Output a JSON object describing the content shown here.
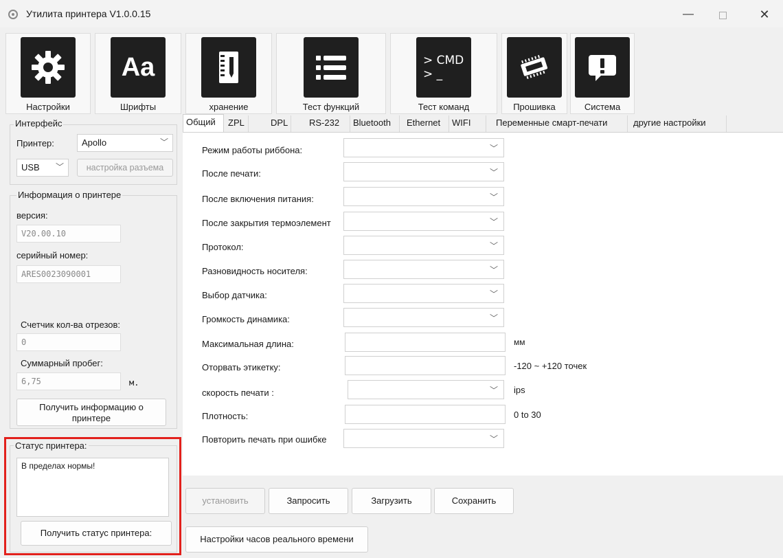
{
  "window": {
    "title": "Утилита принтера  V1.0.0.15",
    "controls": {
      "minimize": "—",
      "close": "✕"
    }
  },
  "toolbar": {
    "buttons": [
      {
        "id": "settings",
        "label": "Настройки",
        "icon": "gear-icon"
      },
      {
        "id": "fonts",
        "label": "Шрифты",
        "icon": "fonts-icon",
        "glyph": "Aa"
      },
      {
        "id": "storage",
        "label": "хранение",
        "icon": "notebook-icon"
      },
      {
        "id": "func_test",
        "label": "Тест функций",
        "icon": "list-icon"
      },
      {
        "id": "cmd_test",
        "label": "Тест команд",
        "icon": "terminal-icon",
        "glyph_line1": "> CMD",
        "glyph_line2": "> _"
      },
      {
        "id": "firmware",
        "label": "Прошивка",
        "icon": "chip-icon"
      },
      {
        "id": "system",
        "label": "Система",
        "icon": "alert-icon",
        "glyph": "!"
      }
    ]
  },
  "interface": {
    "title": "Интерфейс",
    "printer_label": "Принтер:",
    "printer_value": "Apollo",
    "port_value": "USB",
    "port_settings_button": "настройка разъема"
  },
  "printer_info": {
    "title": "Информация о принтере",
    "version_label": "версия:",
    "version_value": "V20.00.10",
    "serial_label": "серийный номер:",
    "serial_value": "ARES0023090001",
    "cut_counter_label": "Счетчик кол-ва отрезов:",
    "cut_counter_value": "0",
    "mileage_label": "Суммарный пробег:",
    "mileage_value": "6,75",
    "mileage_unit": "м.",
    "get_info_button_line1": "Получить информацию о",
    "get_info_button_line2": "принтере"
  },
  "printer_status": {
    "title": "Статус принтера:",
    "text": "В пределах нормы!",
    "get_status_button": "Получить статус принтера:"
  },
  "tabs": [
    {
      "label": "Общий",
      "active": true
    },
    {
      "label": "ZPL"
    },
    {
      "label": "DPL"
    },
    {
      "label": "RS-232"
    },
    {
      "label": "Bluetooth"
    },
    {
      "label": "Ethernet"
    },
    {
      "label": "WIFI"
    },
    {
      "label": "Переменные смарт-печати"
    },
    {
      "label": "другие настройки"
    }
  ],
  "general_form": {
    "fields": [
      {
        "label": "Режим работы риббона:",
        "type": "combo",
        "value": ""
      },
      {
        "label": "После печати:",
        "type": "combo",
        "value": ""
      },
      {
        "label": "После включения питания:",
        "type": "combo",
        "value": ""
      },
      {
        "label": "После закрытия термоэлемент",
        "type": "combo",
        "value": ""
      },
      {
        "label": "Протокол:",
        "type": "combo",
        "value": ""
      },
      {
        "label": "Разновидность носителя:",
        "type": "combo",
        "value": ""
      },
      {
        "label": "Выбор датчика:",
        "type": "combo",
        "value": ""
      },
      {
        "label": "Громкость динамика:",
        "type": "combo",
        "value": ""
      },
      {
        "label": "Максимальная длина:",
        "type": "input",
        "value": "",
        "unit": "мм"
      },
      {
        "label": "Оторвать этикетку:",
        "type": "input",
        "value": "",
        "unit": "-120 ~ +120 точек"
      },
      {
        "label": "скорость печати :",
        "type": "combo",
        "value": "",
        "unit": "ips"
      },
      {
        "label": "Плотность:",
        "type": "input",
        "value": "",
        "unit": "0 to 30"
      },
      {
        "label": "Повторить печать при ошибке",
        "type": "combo",
        "value": ""
      }
    ]
  },
  "actions": {
    "set": "установить",
    "query": "Запросить",
    "load": "Загрузить",
    "save": "Сохранить",
    "rtc": "Настройки часов реального времени"
  },
  "colors": {
    "highlight_box": "#e2211c",
    "icon_bg": "#1f1f1f"
  }
}
